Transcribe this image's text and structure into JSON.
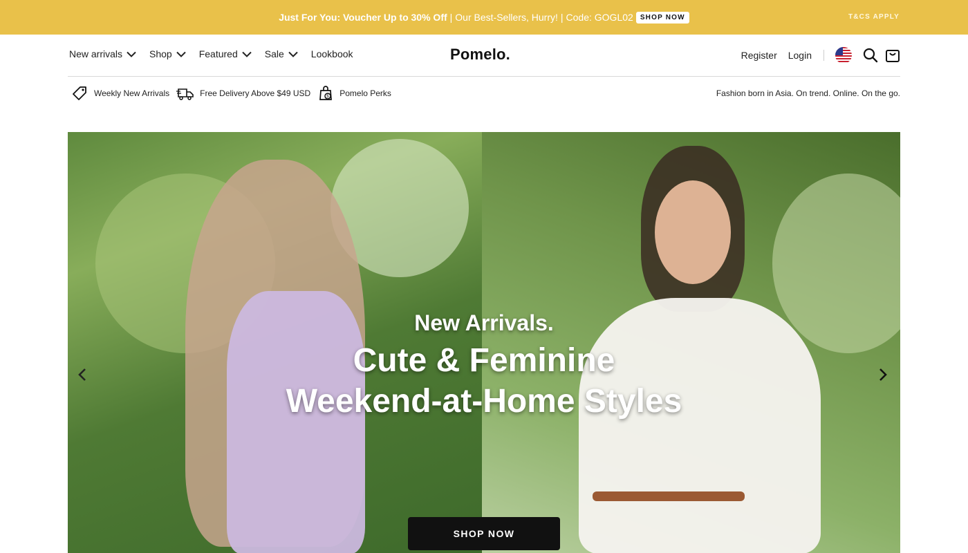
{
  "promo": {
    "headline": "Just For You: Voucher Up to 30% Off",
    "separator_1": "|",
    "middle": "Our Best-Sellers, Hurry!",
    "separator_2": "|",
    "code": "Code: GOGL02",
    "shop_now": "SHOP NOW",
    "terms": "T&CS APPLY",
    "background_color": "#e9c14a"
  },
  "header": {
    "nav": [
      {
        "label": "New arrivals",
        "has_dropdown": true
      },
      {
        "label": "Shop",
        "has_dropdown": true
      },
      {
        "label": "Featured",
        "has_dropdown": true
      },
      {
        "label": "Sale",
        "has_dropdown": true
      },
      {
        "label": "Lookbook",
        "has_dropdown": false
      }
    ],
    "logo": "Pomelo.",
    "register": "Register",
    "login": "Login",
    "icons": [
      "us-flag-icon",
      "search-icon",
      "shopping-bag-icon"
    ]
  },
  "perks": {
    "items": [
      {
        "icon": "price-tag-icon",
        "label": "Weekly New Arrivals"
      },
      {
        "icon": "delivery-truck-icon",
        "label": "Free Delivery Above $49 USD"
      },
      {
        "icon": "perks-bag-icon",
        "label": "Pomelo Perks"
      }
    ],
    "tagline": "Fashion born in Asia. On trend. Online. On the go."
  },
  "hero": {
    "subtitle": "New Arrivals.",
    "line1": "Cute & Feminine",
    "line2": "Weekend-at-Home Styles",
    "cta": "SHOP NOW",
    "prev_icon": "chevron-left-icon",
    "next_icon": "chevron-right-icon"
  }
}
